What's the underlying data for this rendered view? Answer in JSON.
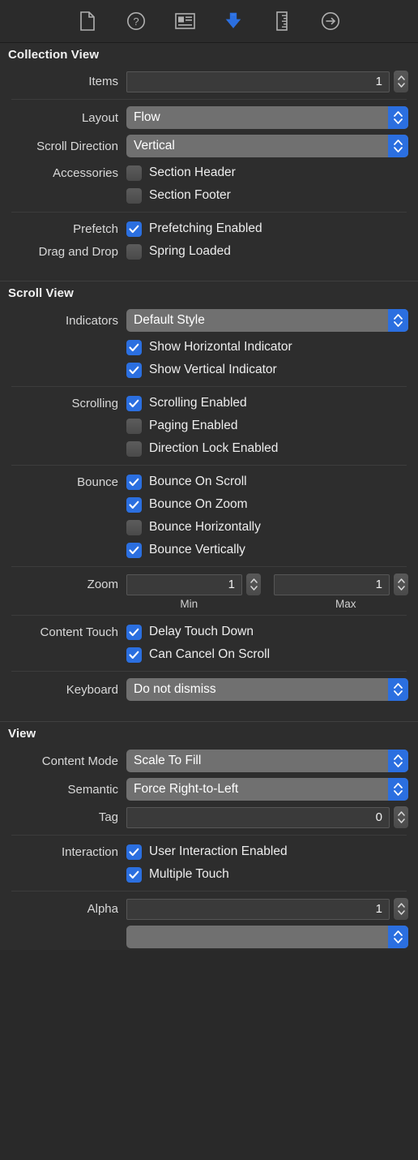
{
  "colors": {
    "accent": "#2b6fe0",
    "panel_bg": "#2d2d2d",
    "toolbar_bg": "#2b2b2b",
    "popup_bg": "#707070",
    "field_bg": "#3a3a3a"
  },
  "toolbar": {
    "items": [
      {
        "icon": "file-inspector-icon",
        "label": "File Inspector",
        "selected": false
      },
      {
        "icon": "quick-help-icon",
        "label": "Quick Help Inspector",
        "selected": false
      },
      {
        "icon": "identity-inspector-icon",
        "label": "Identity Inspector",
        "selected": false
      },
      {
        "icon": "attributes-inspector-icon",
        "label": "Attributes Inspector",
        "selected": true
      },
      {
        "icon": "size-inspector-icon",
        "label": "Size Inspector",
        "selected": false
      },
      {
        "icon": "connections-inspector-icon",
        "label": "Connections Inspector",
        "selected": false
      }
    ]
  },
  "sections": {
    "collection_view": {
      "title": "Collection View",
      "items_label": "Items",
      "items_value": "1",
      "layout_label": "Layout",
      "layout_value": "Flow",
      "scroll_direction_label": "Scroll Direction",
      "scroll_direction_value": "Vertical",
      "accessories_label": "Accessories",
      "section_header": {
        "label": "Section Header",
        "checked": false
      },
      "section_footer": {
        "label": "Section Footer",
        "checked": false
      },
      "prefetch_label": "Prefetch",
      "prefetching_enabled": {
        "label": "Prefetching Enabled",
        "checked": true
      },
      "drag_and_drop_label": "Drag and Drop",
      "spring_loaded": {
        "label": "Spring Loaded",
        "checked": false
      }
    },
    "scroll_view": {
      "title": "Scroll View",
      "indicators_label": "Indicators",
      "indicators_value": "Default Style",
      "show_horizontal_indicator": {
        "label": "Show Horizontal Indicator",
        "checked": true
      },
      "show_vertical_indicator": {
        "label": "Show Vertical Indicator",
        "checked": true
      },
      "scrolling_label": "Scrolling",
      "scrolling_enabled": {
        "label": "Scrolling Enabled",
        "checked": true
      },
      "paging_enabled": {
        "label": "Paging Enabled",
        "checked": false
      },
      "direction_lock_enabled": {
        "label": "Direction Lock Enabled",
        "checked": false
      },
      "bounce_label": "Bounce",
      "bounce_on_scroll": {
        "label": "Bounce On Scroll",
        "checked": true
      },
      "bounce_on_zoom": {
        "label": "Bounce On Zoom",
        "checked": true
      },
      "bounce_horizontally": {
        "label": "Bounce Horizontally",
        "checked": false
      },
      "bounce_vertically": {
        "label": "Bounce Vertically",
        "checked": true
      },
      "zoom_label": "Zoom",
      "zoom_min_value": "1",
      "zoom_max_value": "1",
      "zoom_min_sublabel": "Min",
      "zoom_max_sublabel": "Max",
      "content_touch_label": "Content Touch",
      "delay_touch_down": {
        "label": "Delay Touch Down",
        "checked": true
      },
      "can_cancel_on_scroll": {
        "label": "Can Cancel On Scroll",
        "checked": true
      },
      "keyboard_label": "Keyboard",
      "keyboard_value": "Do not dismiss"
    },
    "view": {
      "title": "View",
      "content_mode_label": "Content Mode",
      "content_mode_value": "Scale To Fill",
      "semantic_label": "Semantic",
      "semantic_value": "Force Right-to-Left",
      "tag_label": "Tag",
      "tag_value": "0",
      "interaction_label": "Interaction",
      "user_interaction_enabled": {
        "label": "User Interaction Enabled",
        "checked": true
      },
      "multiple_touch": {
        "label": "Multiple Touch",
        "checked": true
      },
      "alpha_label": "Alpha",
      "alpha_value": "1"
    }
  }
}
